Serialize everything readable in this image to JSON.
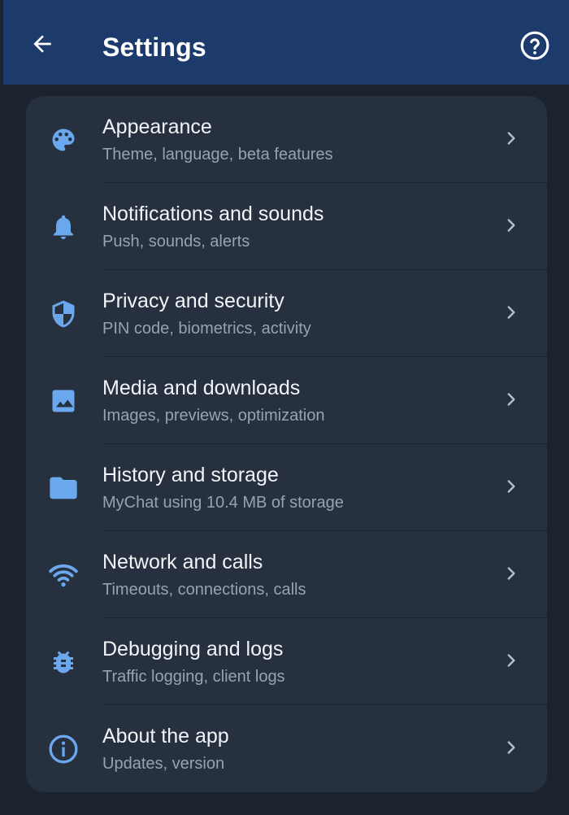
{
  "header": {
    "title": "Settings",
    "back_icon": "arrow-left-icon",
    "help_icon": "help-circle-icon"
  },
  "colors": {
    "header_bg": "#1c3a6b",
    "page_bg": "#1b232e",
    "card_bg": "#26303e",
    "icon_accent": "#6aa7ec",
    "text_primary": "#f1f4f8",
    "text_secondary": "#98a2b0"
  },
  "settings": {
    "items": [
      {
        "label": "Appearance",
        "subtitle": "Theme, language, beta features",
        "icon": "palette-icon"
      },
      {
        "label": "Notifications and sounds",
        "subtitle": "Push, sounds, alerts",
        "icon": "bell-icon"
      },
      {
        "label": "Privacy and security",
        "subtitle": "PIN code, biometrics, activity",
        "icon": "shield-icon"
      },
      {
        "label": "Media and downloads",
        "subtitle": "Images, previews, optimization",
        "icon": "image-icon"
      },
      {
        "label": "History and storage",
        "subtitle": "MyChat using 10.4 MB of storage",
        "icon": "folder-icon"
      },
      {
        "label": "Network and calls",
        "subtitle": "Timeouts, connections, calls",
        "icon": "wifi-icon"
      },
      {
        "label": "Debugging and logs",
        "subtitle": "Traffic logging, client logs",
        "icon": "bug-icon"
      },
      {
        "label": "About the app",
        "subtitle": "Updates, version",
        "icon": "info-icon"
      }
    ]
  }
}
